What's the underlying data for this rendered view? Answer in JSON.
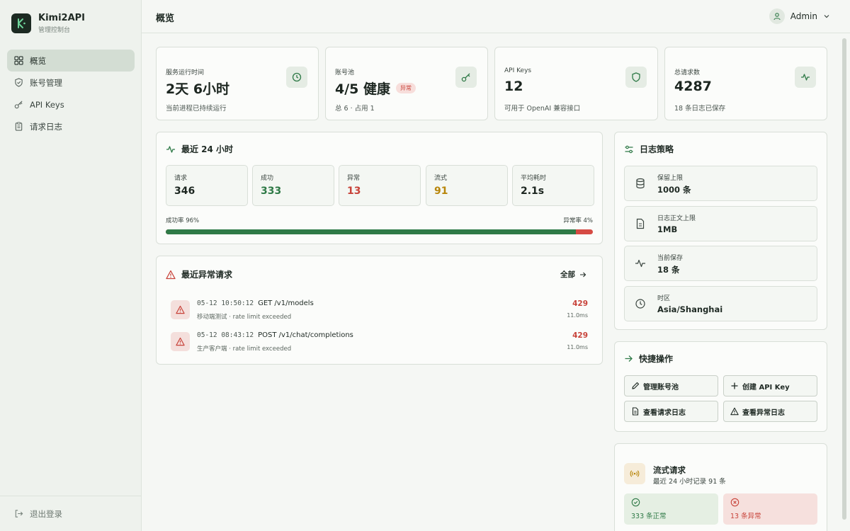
{
  "brand": {
    "name": "Kimi2API",
    "subtitle": "管理控制台"
  },
  "nav": [
    {
      "label": "概览",
      "icon": "grid-icon",
      "active": true
    },
    {
      "label": "账号管理",
      "icon": "shield-icon"
    },
    {
      "label": "API Keys",
      "icon": "key-icon"
    },
    {
      "label": "请求日志",
      "icon": "clipboard-icon"
    }
  ],
  "logout_label": "退出登录",
  "header": {
    "title": "概览",
    "user": "Admin"
  },
  "stats": [
    {
      "label": "服务运行时间",
      "value": "2天 6小时",
      "sub": "当前进程已持续运行",
      "icon": "clock-icon"
    },
    {
      "label": "账号池",
      "value": "4/5 健康",
      "badge": "异常",
      "sub": "总 6 · 占用 1",
      "icon": "key-icon"
    },
    {
      "label": "API Keys",
      "value": "12",
      "sub": "可用于 OpenAI 兼容接口",
      "icon": "shield-icon"
    },
    {
      "label": "总请求数",
      "value": "4287",
      "sub": "18 条日志已保存",
      "icon": "activity-icon"
    }
  ],
  "last24": {
    "title": "最近 24 小时",
    "metrics": [
      {
        "label": "请求",
        "value": "346",
        "color": "#1c2620"
      },
      {
        "label": "成功",
        "value": "333",
        "color": "#2f7a47"
      },
      {
        "label": "异常",
        "value": "13",
        "color": "#c8433a"
      },
      {
        "label": "流式",
        "value": "91",
        "color": "#b8860b"
      },
      {
        "label": "平均耗时",
        "value": "2.1s",
        "color": "#1c2620"
      }
    ],
    "success_rate_label": "成功率 96%",
    "error_rate_label": "异常率 4%",
    "success_fraction": 0.96
  },
  "errors": {
    "title": "最近异常请求",
    "all_label": "全部",
    "items": [
      {
        "time": "05-12 10:50:12",
        "request": "GET /v1/models",
        "detail": "移动端测试 · rate limit exceeded",
        "code": "429",
        "duration": "11.0ms"
      },
      {
        "time": "05-12 08:43:12",
        "request": "POST /v1/chat/completions",
        "detail": "生产客户端 · rate limit exceeded",
        "code": "429",
        "duration": "11.0ms"
      }
    ]
  },
  "policy": {
    "title": "日志策略",
    "items": [
      {
        "label": "保留上限",
        "value": "1000 条",
        "icon": "database-icon"
      },
      {
        "label": "日志正文上限",
        "value": "1MB",
        "icon": "file-icon"
      },
      {
        "label": "当前保存",
        "value": "18 条",
        "icon": "activity-icon"
      },
      {
        "label": "时区",
        "value": "Asia/Shanghai",
        "icon": "clock-icon"
      }
    ]
  },
  "quick": {
    "title": "快捷操作",
    "buttons": [
      {
        "label": "管理账号池",
        "icon": "pencil-icon"
      },
      {
        "label": "创建 API Key",
        "icon": "plus-icon"
      },
      {
        "label": "查看请求日志",
        "icon": "file-icon"
      },
      {
        "label": "查看异常日志",
        "icon": "warning-icon"
      }
    ]
  },
  "stream": {
    "title": "流式请求",
    "sub": "最近 24 小时记录 91 条",
    "ok_label": "333 条正常",
    "err_label": "13 条异常"
  },
  "colors": {
    "accent": "#2f7a47",
    "danger": "#c8433a",
    "warning": "#b8860b",
    "sidebar": "#eef2ed"
  }
}
